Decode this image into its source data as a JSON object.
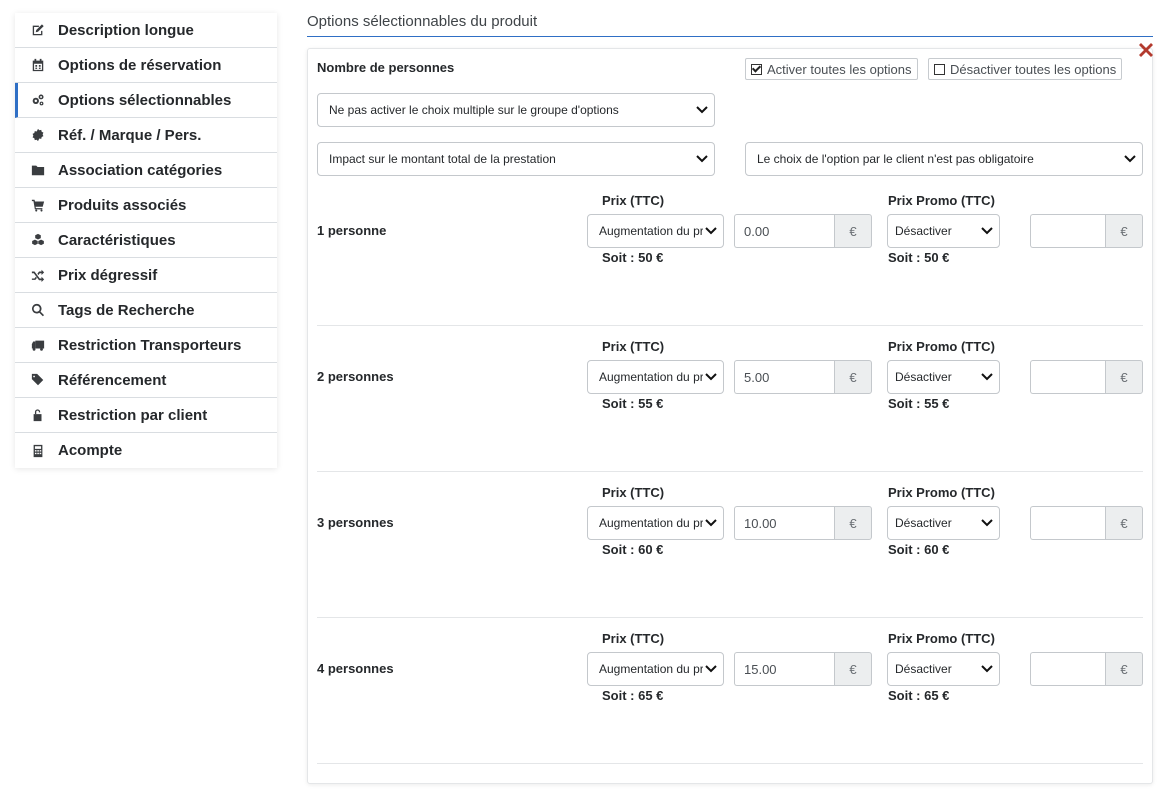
{
  "sidebar": {
    "items": [
      {
        "label": "Description longue",
        "icon": "edit-icon"
      },
      {
        "label": "Options de réservation",
        "icon": "calendar-icon"
      },
      {
        "label": "Options sélectionnables",
        "icon": "gears-icon",
        "active": true
      },
      {
        "label": "Réf. / Marque / Pers.",
        "icon": "badge-icon"
      },
      {
        "label": "Association catégories",
        "icon": "folder-icon"
      },
      {
        "label": "Produits associés",
        "icon": "cart-icon"
      },
      {
        "label": "Caractéristiques",
        "icon": "cubes-icon"
      },
      {
        "label": "Prix dégressif",
        "icon": "shuffle-icon"
      },
      {
        "label": "Tags de Recherche",
        "icon": "search-icon"
      },
      {
        "label": "Restriction Transporteurs",
        "icon": "truck-icon"
      },
      {
        "label": "Référencement",
        "icon": "tags-icon"
      },
      {
        "label": "Restriction par client",
        "icon": "unlock-icon"
      },
      {
        "label": "Acompte",
        "icon": "calculator-icon"
      }
    ]
  },
  "main": {
    "section_title": "Options sélectionnables du produit",
    "group_title": "Nombre de personnes",
    "activate_all_label": "Activer toutes les options",
    "deactivate_all_label": "Désactiver toutes les options",
    "multi_choice_select": "Ne pas activer le choix multiple sur le groupe d'options",
    "impact_select": "Impact sur le montant total de la prestation",
    "required_select": "Le choix de l'option par le client n'est pas obligatoire",
    "options": [
      {
        "label": "1 personne",
        "price_head": "Prix (TTC)",
        "price_mode": "Augmentation du prix",
        "price_value": "0.00",
        "currency": "€",
        "price_total": "Soit : 50 €",
        "promo_head": "Prix Promo (TTC)",
        "promo_mode": "Désactiver",
        "promo_value": "",
        "promo_currency": "€",
        "promo_total": "Soit : 50 €"
      },
      {
        "label": "2 personnes",
        "price_head": "Prix (TTC)",
        "price_mode": "Augmentation du prix",
        "price_value": "5.00",
        "currency": "€",
        "price_total": "Soit : 55 €",
        "promo_head": "Prix Promo (TTC)",
        "promo_mode": "Désactiver",
        "promo_value": "",
        "promo_currency": "€",
        "promo_total": "Soit : 55 €"
      },
      {
        "label": "3 personnes",
        "price_head": "Prix (TTC)",
        "price_mode": "Augmentation du prix",
        "price_value": "10.00",
        "currency": "€",
        "price_total": "Soit : 60 €",
        "promo_head": "Prix Promo (TTC)",
        "promo_mode": "Désactiver",
        "promo_value": "",
        "promo_currency": "€",
        "promo_total": "Soit : 60 €"
      },
      {
        "label": "4 personnes",
        "price_head": "Prix (TTC)",
        "price_mode": "Augmentation du prix",
        "price_value": "15.00",
        "currency": "€",
        "price_total": "Soit : 65 €",
        "promo_head": "Prix Promo (TTC)",
        "promo_mode": "Désactiver",
        "promo_value": "",
        "promo_currency": "€",
        "promo_total": "Soit : 65 €"
      }
    ]
  },
  "colors": {
    "accent": "#2f6fc5",
    "delete": "#b33a2e"
  }
}
